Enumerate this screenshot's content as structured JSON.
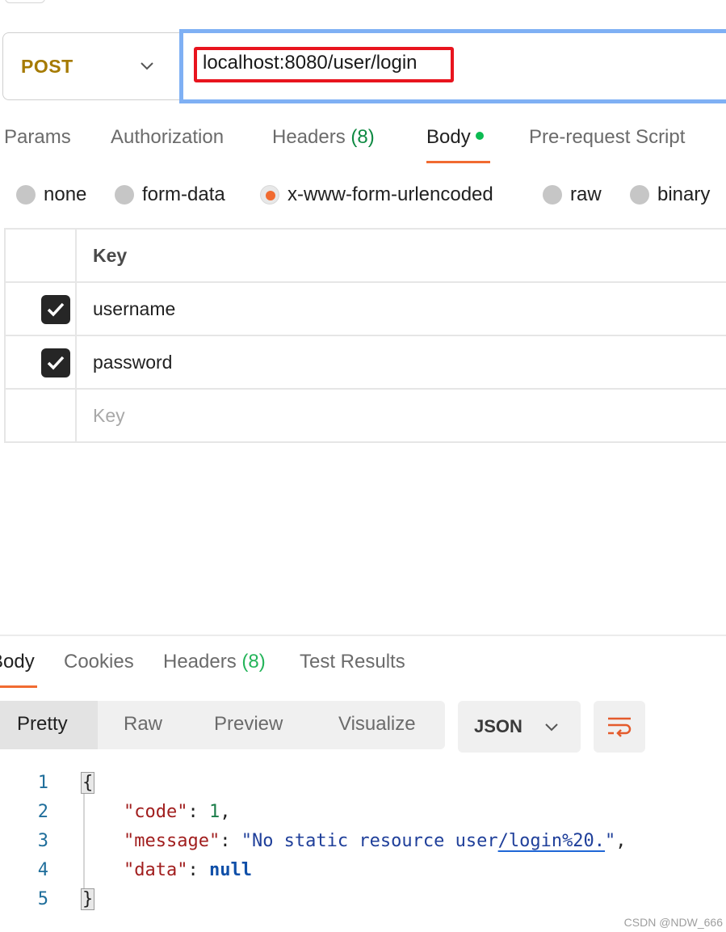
{
  "request": {
    "method": "POST",
    "url": "localhost:8080/user/login"
  },
  "request_tabs": [
    {
      "label": "Params"
    },
    {
      "label": "Authorization"
    },
    {
      "label": "Headers",
      "count": "(8)"
    },
    {
      "label": "Body"
    },
    {
      "label": "Pre-request Script"
    }
  ],
  "body_types": [
    {
      "label": "none",
      "selected": false
    },
    {
      "label": "form-data",
      "selected": false
    },
    {
      "label": "x-www-form-urlencoded",
      "selected": true
    },
    {
      "label": "raw",
      "selected": false
    },
    {
      "label": "binary",
      "selected": false
    }
  ],
  "params_table": {
    "header": "Key",
    "rows": [
      {
        "key": "username",
        "checked": true
      },
      {
        "key": "password",
        "checked": true
      }
    ],
    "placeholder": "Key"
  },
  "response_tabs": [
    {
      "label": "Body"
    },
    {
      "label": "Cookies"
    },
    {
      "label": "Headers",
      "count": "(8)"
    },
    {
      "label": "Test Results"
    }
  ],
  "view_modes": [
    "Pretty",
    "Raw",
    "Preview",
    "Visualize"
  ],
  "format": "JSON",
  "code": {
    "line_numbers": [
      "1",
      "2",
      "3",
      "4",
      "5"
    ],
    "open_brace": "{",
    "close_brace": "}",
    "code_key": "\"code\"",
    "code_value": "1",
    "message_key": "\"message\"",
    "message_value_start": "\"No static resource user",
    "message_value_link": "/login%20.",
    "message_value_end": "\"",
    "data_key": "\"data\"",
    "data_value": "null"
  },
  "watermark": "CSDN @NDW_666",
  "colors": {
    "method": "#a57a00",
    "accent": "#f16b31",
    "url_focus": "#7fb0f4",
    "highlight": "#e8141e",
    "count_green": "#0f8a43"
  }
}
